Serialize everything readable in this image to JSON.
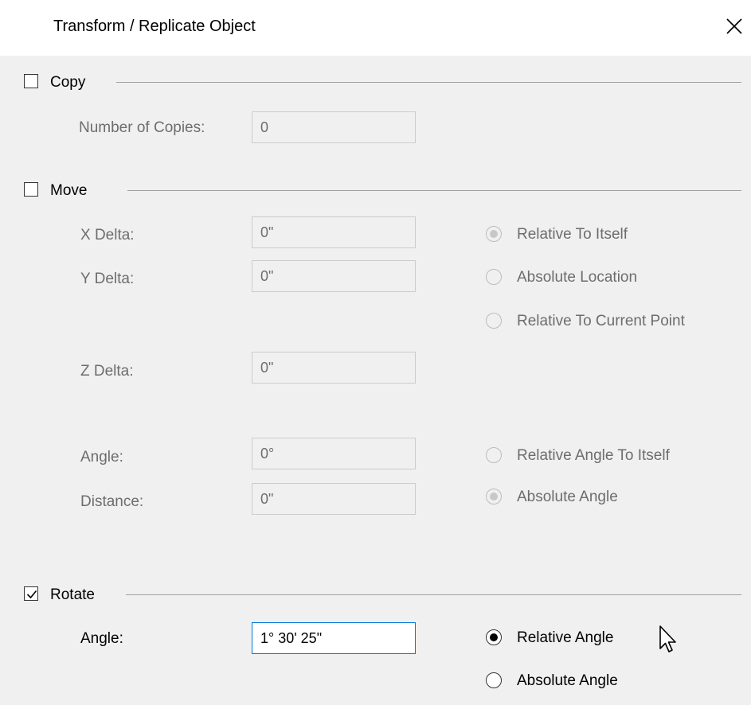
{
  "window": {
    "title": "Transform / Replicate Object",
    "close_icon": "close-icon"
  },
  "copy": {
    "label": "Copy",
    "checked": false,
    "number_label": "Number of Copies:",
    "number_value": "0"
  },
  "move": {
    "label": "Move",
    "checked": false,
    "x_label": "X Delta:",
    "x_value": "0\"",
    "y_label": "Y Delta:",
    "y_value": "0\"",
    "z_label": "Z Delta:",
    "z_value": "0\"",
    "angle_label": "Angle:",
    "angle_value": "0°",
    "distance_label": "Distance:",
    "distance_value": "0\"",
    "location_options": [
      "Relative To Itself",
      "Absolute Location",
      "Relative To Current Point"
    ],
    "location_selected": "Relative To Itself",
    "angle_options": [
      "Relative Angle To Itself",
      "Absolute Angle"
    ],
    "angle_selected": "Absolute Angle"
  },
  "rotate": {
    "label": "Rotate",
    "checked": true,
    "angle_label": "Angle:",
    "angle_value": "1° 30' 25\"",
    "options": [
      "Relative Angle",
      "Absolute Angle"
    ],
    "selected": "Relative Angle"
  },
  "colors": {
    "accent": "#0078d7",
    "disabled_text": "#6d6d6d"
  }
}
